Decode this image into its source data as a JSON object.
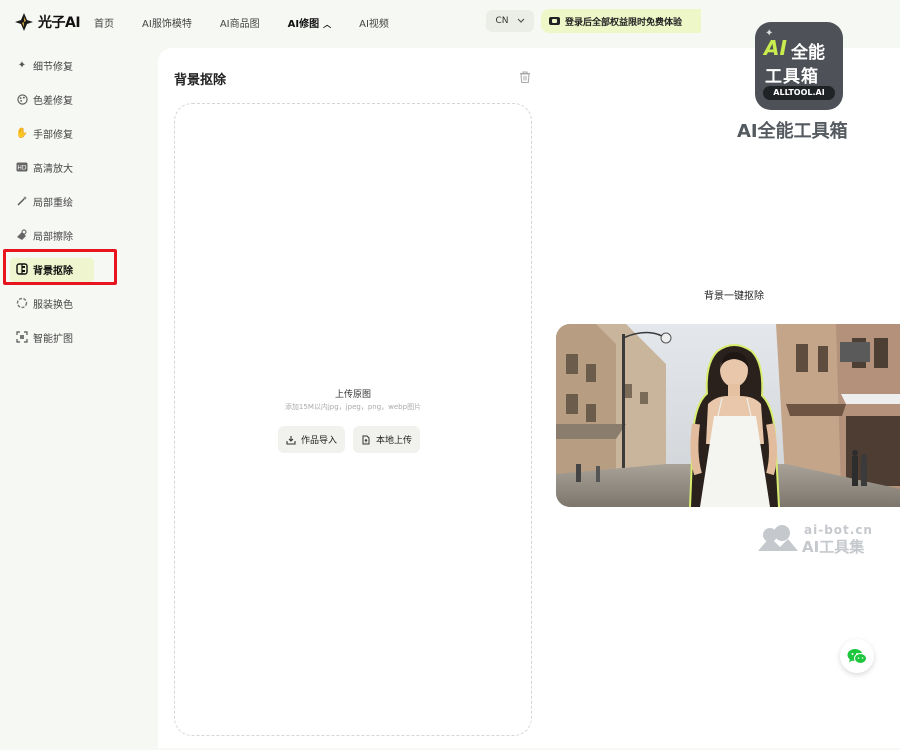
{
  "header": {
    "logo_text": "光子AI",
    "nav": [
      {
        "label": "首页"
      },
      {
        "label": "AI服饰模特"
      },
      {
        "label": "AI商品图"
      },
      {
        "label": "AI修图"
      },
      {
        "label": "AI视频"
      }
    ],
    "language": "CN",
    "promo_text": "登录后全部权益限时免费体验"
  },
  "sidebar": {
    "items": [
      {
        "label": "细节修复",
        "icon": "sparkle-icon"
      },
      {
        "label": "色差修复",
        "icon": "palette-icon"
      },
      {
        "label": "手部修复",
        "icon": "hand-icon"
      },
      {
        "label": "高清放大",
        "icon": "hd-icon"
      },
      {
        "label": "局部重绘",
        "icon": "magic-wand-icon"
      },
      {
        "label": "局部擦除",
        "icon": "eraser-icon"
      },
      {
        "label": "背景抠除",
        "icon": "background-remove-icon"
      },
      {
        "label": "服装换色",
        "icon": "color-swap-icon"
      },
      {
        "label": "智能扩图",
        "icon": "expand-icon"
      }
    ],
    "active_index": 6
  },
  "main": {
    "title": "背景抠除",
    "upload_title": "上传原图",
    "upload_hint": "添加15M以内jpg，jpeg，png，webp图片",
    "import_button": "作品导入",
    "local_upload_button": "本地上传"
  },
  "right": {
    "badge_ai": "AI",
    "badge_line1": "全能",
    "badge_line2": "工具箱",
    "badge_domain": "ALLTOOL.AI",
    "badge_caption": "AI全能工具箱",
    "caption": "背景一键抠除",
    "watermark_domain": "ai-bot.cn",
    "watermark_name": "AI工具集"
  },
  "colors": {
    "accent": "#eef5cf",
    "highlight": "#e8151e",
    "brand_lime": "#c9ec4e"
  }
}
